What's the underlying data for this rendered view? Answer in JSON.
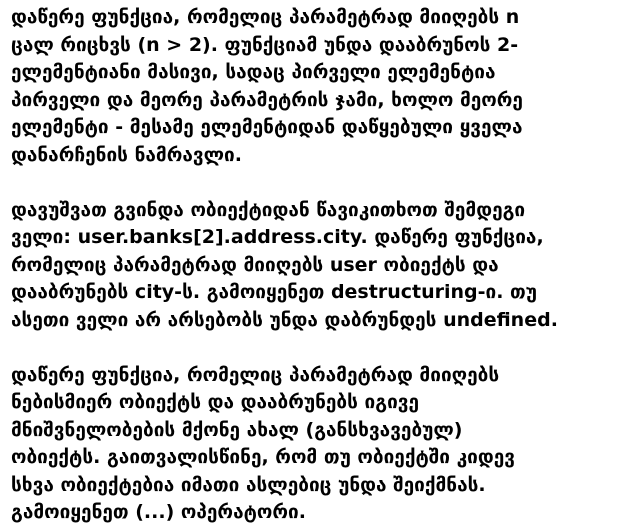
{
  "paragraphs": [
    {
      "lines": [
        "დაწერე ფუნქცია, რომელიც პარამეტრად მიიღებს n",
        "ცალ რიცხვს (n > 2). ფუნქციამ უნდა დააბრუნოს 2-",
        "ელემენტიანი მასივი, სადაც პირველი ელემენტია",
        "პირველი და მეორე პარამეტრის ჯამი, ხოლო მეორე",
        "ელემენტი - მესამე ელემენტიდან დაწყებული ყველა",
        "დანარჩენის ნამრავლი."
      ]
    },
    {
      "lines": [
        "დავუშვათ გვინდა ობიექტიდან წავიკითხოთ შემდეგი",
        "ველი: user.banks[2].address.city. დაწერე ფუნქცია,",
        "რომელიც პარამეტრად მიიღებს user ობიექტს და",
        "დააბრუნებს city-ს. გამოიყენეთ destructuring-ი. თუ",
        "ასეთი ველი არ არსებობს უნდა დაბრუნდეს undefined."
      ]
    },
    {
      "lines": [
        "დაწერე ფუნქცია, რომელიც პარამეტრად მიიღებს",
        "ნებისმიერ ობიექტს და დააბრუნებს იგივე",
        "მნიშვნელობების მქონე ახალ (განსხვავებულ)",
        "ობიექტს. გაითვალისწინე, რომ თუ  ობიექტში კიდევ",
        "სხვა ობიექტებია იმათი ასლებიც უნდა შეიქმნას.",
        "გამოიყენეთ (...) ოპერატორი."
      ]
    }
  ]
}
